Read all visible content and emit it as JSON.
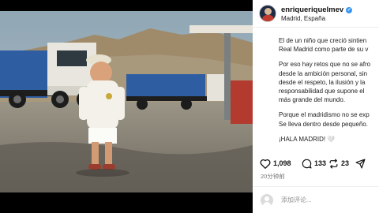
{
  "post": {
    "username": "enriqueriquelmev",
    "location": "Madrid, España",
    "caption": [
      "El de un niño que creció sintien",
      "Real Madrid como parte de su v",
      "Por eso hay retos que no se afro",
      "desde la ambición personal, sin",
      "desde el respeto, la ilusión y la",
      "responsabilidad que supone el",
      "más grande del mundo.",
      "Porque el madridismo no se exp",
      "Se lleva dentro desde pequeño.",
      "¡HALA MADRID! 🤍"
    ],
    "likes": "1,098",
    "comments": "133",
    "reposts": "23",
    "time": "20分钟前",
    "comment_placeholder": "添加评论..."
  },
  "icons": {
    "verified": "verified-badge-icon",
    "like": "heart-icon",
    "comment": "comment-bubble-icon",
    "repost": "repost-icon",
    "share": "send-icon"
  },
  "colors": {
    "verified": "#3897f0",
    "panel_bg": "#ffffff",
    "frame_bg": "#000000"
  }
}
